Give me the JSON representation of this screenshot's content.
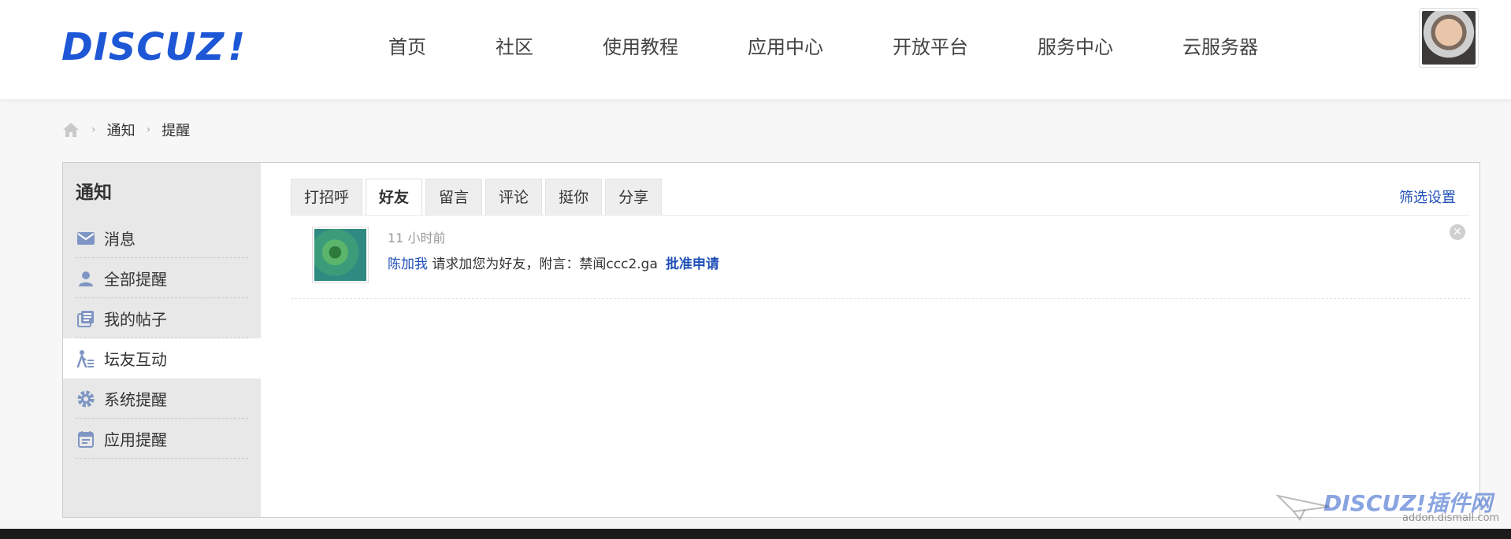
{
  "header": {
    "logo_text": "DISCUZ",
    "logo_bang": "!",
    "nav": [
      "首页",
      "社区",
      "使用教程",
      "应用中心",
      "开放平台",
      "服务中心",
      "云服务器"
    ]
  },
  "breadcrumb": {
    "items": [
      "通知",
      "提醒"
    ]
  },
  "sidebar": {
    "title": "通知",
    "items": [
      {
        "label": "消息",
        "icon": "envelope-icon"
      },
      {
        "label": "全部提醒",
        "icon": "user-icon"
      },
      {
        "label": "我的帖子",
        "icon": "posts-icon"
      },
      {
        "label": "坛友互动",
        "icon": "interaction-icon",
        "active": true
      },
      {
        "label": "系统提醒",
        "icon": "gear-icon"
      },
      {
        "label": "应用提醒",
        "icon": "calendar-icon"
      }
    ]
  },
  "tabs": {
    "items": [
      "打招呼",
      "好友",
      "留言",
      "评论",
      "挺你",
      "分享"
    ],
    "active": "好友",
    "filter_label": "筛选设置"
  },
  "notice": {
    "time": "11 小时前",
    "user": "陈加我",
    "message": " 请求加您为好友，附言：禁闻ccc2.ga",
    "approve_label": "批准申请",
    "close_glyph": "✕"
  },
  "watermark": {
    "main": "DISCUZ!插件网",
    "sub": "addon.dismall.com"
  },
  "colors": {
    "accent": "#1f4fb8",
    "logo": "#1e57d6",
    "sidebar_bg": "#e8e8e8"
  }
}
